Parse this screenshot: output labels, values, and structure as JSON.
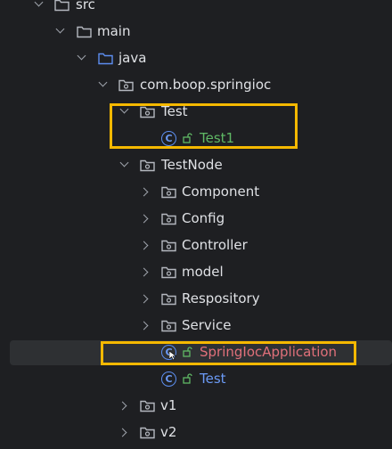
{
  "tree": {
    "src": "src",
    "main": "main",
    "java": "java",
    "package": "com.boop.springioc",
    "test_folder": "Test",
    "test1_class": "Test1",
    "testnode_folder": "TestNode",
    "component": "Component",
    "config": "Config",
    "controller": "Controller",
    "model": "model",
    "respository": "Respository",
    "service": "Service",
    "app_class": "SpringIocApplication",
    "test_class": "Test",
    "v1": "v1",
    "v2": "v2"
  },
  "colors": {
    "highlight_box": "#f5b800",
    "green_text": "#5fb865",
    "red_text": "#e0707a",
    "blue_text": "#6b9af5"
  }
}
